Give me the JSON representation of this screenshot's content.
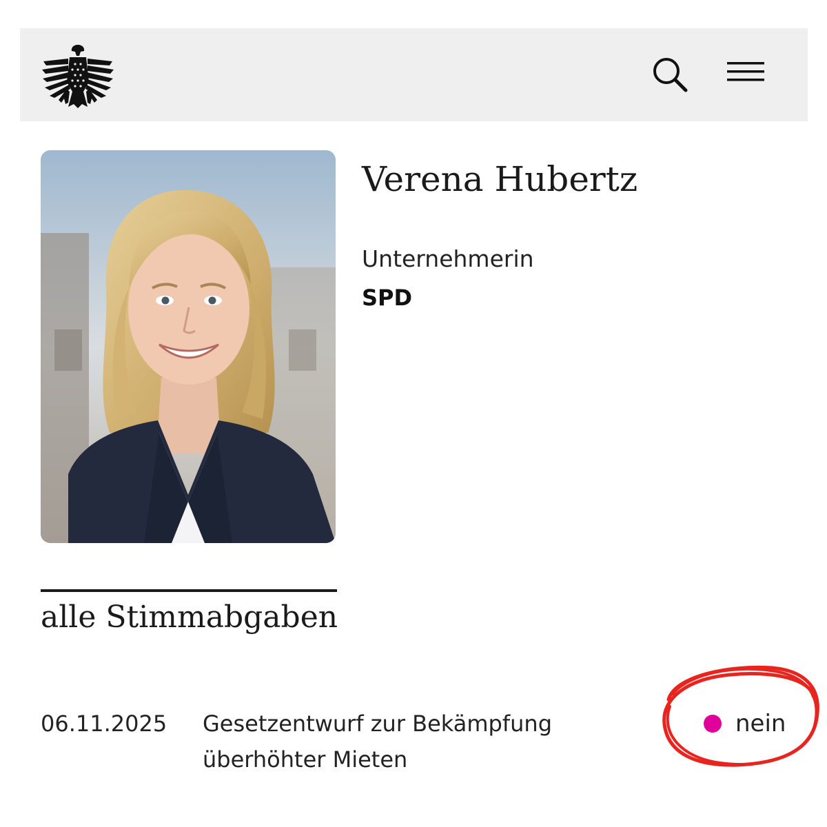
{
  "header": {
    "logo_icon": "federal-eagle-icon",
    "search_icon": "search-icon",
    "menu_icon": "hamburger-menu-icon"
  },
  "profile": {
    "name": "Verena Hubertz",
    "profession": "Unternehmerin",
    "party": "SPD"
  },
  "votes_section": {
    "title": "alle Stimmabgaben",
    "votes": [
      {
        "date": "06.11.2025",
        "title": "Gesetzentwurf zur Bekämpfung überhöhter Mieten",
        "result": "nein",
        "result_color": "#e0009a"
      }
    ]
  },
  "annotation": {
    "color": "#e8241f"
  }
}
